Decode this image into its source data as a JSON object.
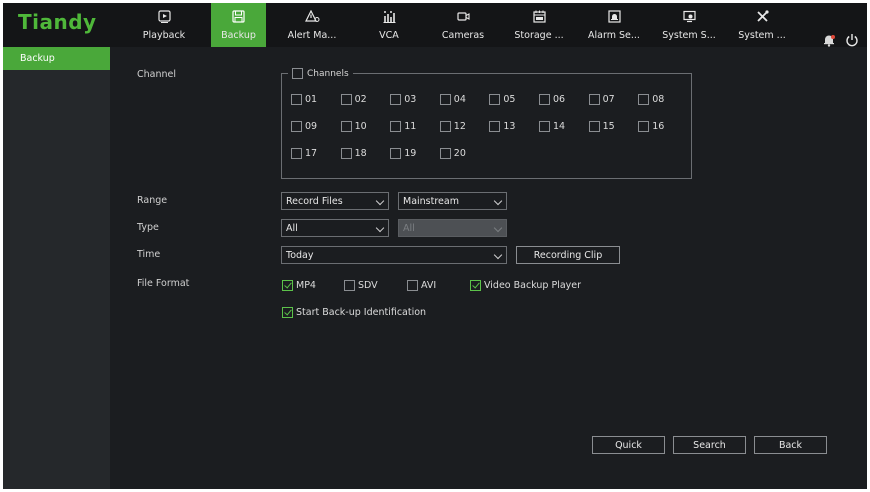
{
  "brand": {
    "logo_text": "Tiandy",
    "accent": "#4aa83a"
  },
  "nav": [
    {
      "label": "Playback",
      "icon": "playback-icon"
    },
    {
      "label": "Backup",
      "icon": "save-icon",
      "active": true
    },
    {
      "label": "Alert Ma...",
      "icon": "alert-icon"
    },
    {
      "label": "VCA",
      "icon": "vca-icon"
    },
    {
      "label": "Cameras",
      "icon": "camera-icon"
    },
    {
      "label": "Storage ...",
      "icon": "storage-icon"
    },
    {
      "label": "Alarm Se...",
      "icon": "alarm-icon"
    },
    {
      "label": "System S...",
      "icon": "system-settings-icon"
    },
    {
      "label": "System ...",
      "icon": "tools-icon"
    }
  ],
  "sidebar": {
    "items": [
      {
        "label": "Backup",
        "active": true
      }
    ]
  },
  "form": {
    "channel_label": "Channel",
    "channels_header": "Channels",
    "channels": [
      "01",
      "02",
      "03",
      "04",
      "05",
      "06",
      "07",
      "08",
      "09",
      "10",
      "11",
      "12",
      "13",
      "14",
      "15",
      "16",
      "17",
      "18",
      "19",
      "20"
    ],
    "range_label": "Range",
    "range_value": "Record Files",
    "stream_value": "Mainstream",
    "type_label": "Type",
    "type_value": "All",
    "type2_value": "All",
    "time_label": "Time",
    "time_value": "Today",
    "recording_clip": "Recording Clip",
    "file_format_label": "File Format",
    "formats": [
      {
        "label": "MP4",
        "checked": true
      },
      {
        "label": "SDV",
        "checked": false
      },
      {
        "label": "AVI",
        "checked": false
      },
      {
        "label": "Video Backup Player",
        "checked": true
      }
    ],
    "identification": {
      "label": "Start Back-up Identification",
      "checked": true
    }
  },
  "actions": {
    "quick": "Quick",
    "search": "Search",
    "back": "Back"
  }
}
